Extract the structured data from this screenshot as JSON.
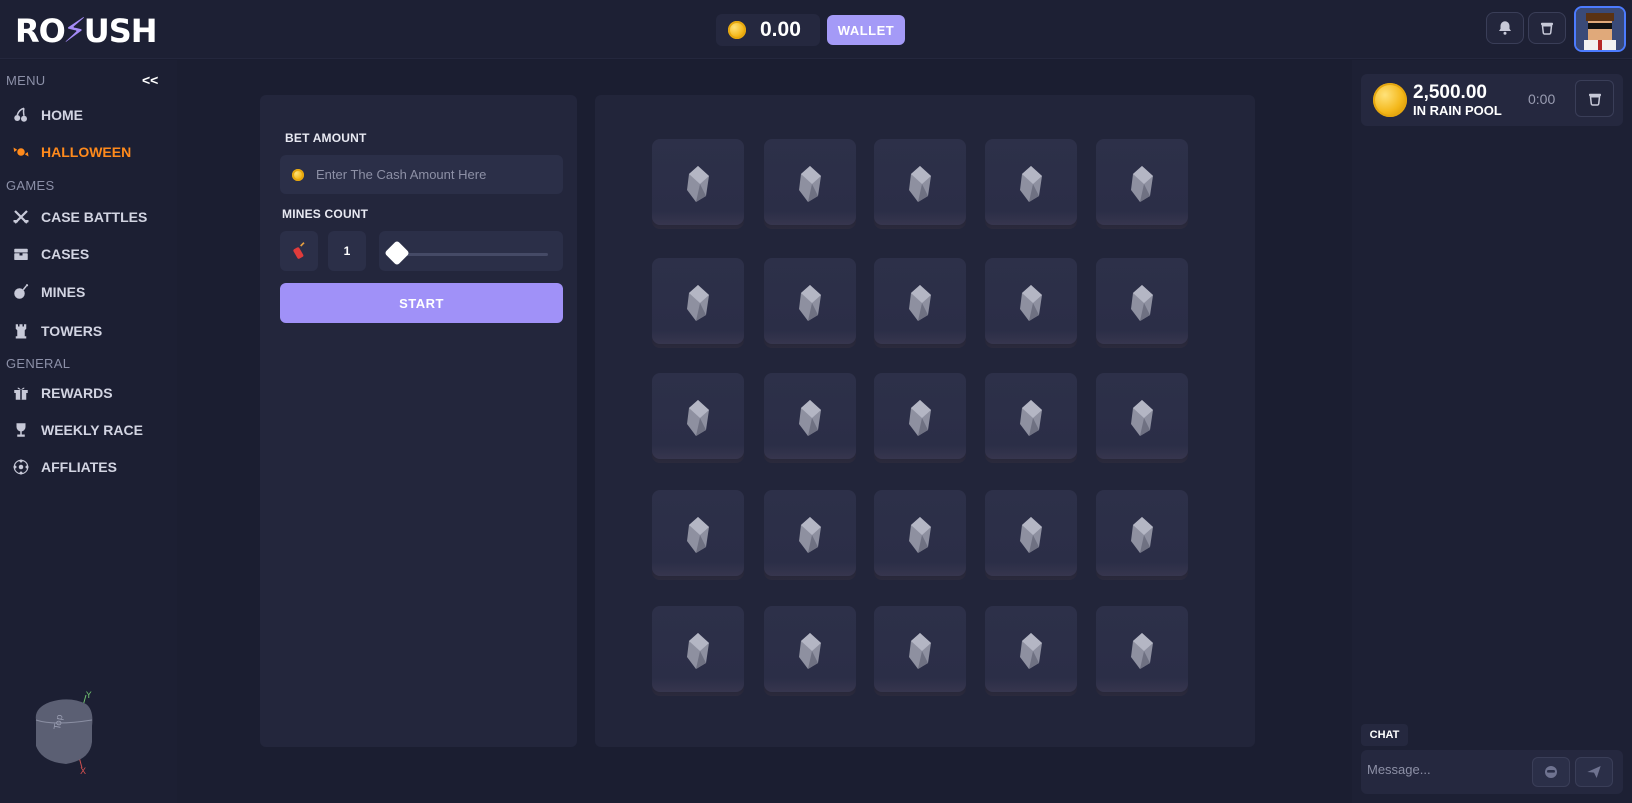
{
  "header": {
    "logo_left": "RO",
    "logo_right": "USH",
    "balance": "0.00",
    "wallet_label": "WALLET"
  },
  "sidebar": {
    "menu_heading": "MENU",
    "collapse_label": "<<",
    "games_heading": "GAMES",
    "general_heading": "GENERAL",
    "items": [
      {
        "label": "HOME",
        "icon": "cherries-icon"
      },
      {
        "label": "HALLOWEEN",
        "icon": "candy-icon",
        "active": true
      },
      {
        "label": "CASE BATTLES",
        "icon": "crossed-swords-icon"
      },
      {
        "label": "CASES",
        "icon": "case-icon"
      },
      {
        "label": "MINES",
        "icon": "bomb-icon"
      },
      {
        "label": "TOWERS",
        "icon": "tower-icon"
      },
      {
        "label": "REWARDS",
        "icon": "gift-icon"
      },
      {
        "label": "WEEKLY RACE",
        "icon": "trophy-icon"
      },
      {
        "label": "AFFLIATES",
        "icon": "network-icon"
      }
    ],
    "gizmo": {
      "y_label": "Y",
      "x_label": "X",
      "face_label": "Top"
    }
  },
  "game": {
    "bet_label": "BET AMOUNT",
    "bet_placeholder": "Enter The Cash Amount Here",
    "mines_label": "MINES COUNT",
    "mines_count": "1",
    "mines_slider_value": 1,
    "start_label": "START",
    "grid_rows": 5,
    "grid_cols": 5,
    "tile_icon": "gem-icon"
  },
  "rain": {
    "amount": "2,500.00",
    "label": "IN RAIN POOL",
    "timer": "0:00"
  },
  "chat": {
    "tab_label": "CHAT",
    "placeholder": "Message..."
  },
  "colors": {
    "accent": "#a091f8",
    "active": "#ff8a1c",
    "background": "#1a1d30"
  }
}
